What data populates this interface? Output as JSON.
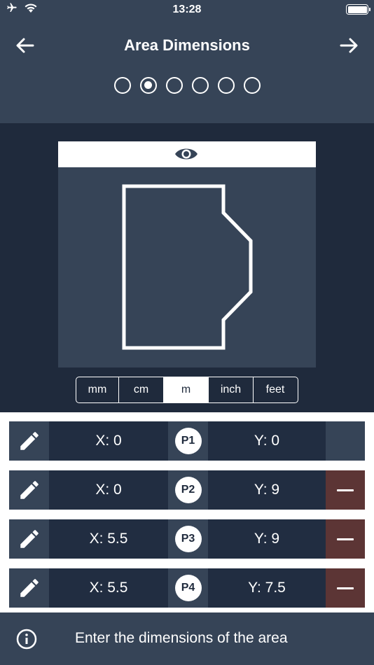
{
  "status_bar": {
    "time": "13:28"
  },
  "nav": {
    "title": "Area Dimensions"
  },
  "steps": {
    "total": 6,
    "active_index": 1
  },
  "units": {
    "options": [
      "mm",
      "cm",
      "m",
      "inch",
      "feet"
    ],
    "selected": "m"
  },
  "points": [
    {
      "label": "P1",
      "x": "X: 0",
      "y": "Y: 0",
      "removable": false
    },
    {
      "label": "P2",
      "x": "X: 0",
      "y": "Y: 9",
      "removable": true
    },
    {
      "label": "P3",
      "x": "X: 5.5",
      "y": "Y: 9",
      "removable": true
    },
    {
      "label": "P4",
      "x": "X: 5.5",
      "y": "Y: 7.5",
      "removable": true
    }
  ],
  "footer": {
    "hint": "Enter the dimensions of the area"
  },
  "colors": {
    "header_bg": "#364457",
    "workspace_bg": "#1f2a3c",
    "remove_bg": "#5c3535"
  },
  "icons": {
    "status_left": [
      "airplane-icon",
      "wifi-icon"
    ],
    "status_right": "battery-icon",
    "back": "arrow-left-icon",
    "next": "arrow-right-icon",
    "preview": "eye-icon",
    "edit": "pencil-icon",
    "remove": "minus-icon",
    "footer": "info-icon"
  }
}
